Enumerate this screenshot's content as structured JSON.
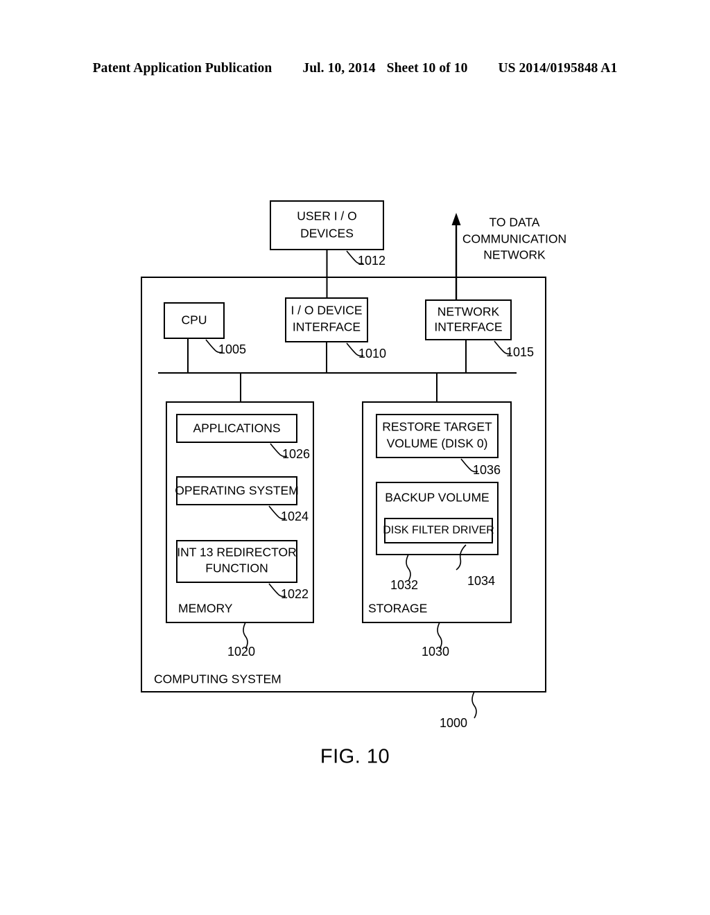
{
  "header": {
    "publication": "Patent Application Publication",
    "date": "Jul. 10, 2014",
    "sheet": "Sheet 10 of 10",
    "number": "US 2014/0195848 A1"
  },
  "figure": {
    "caption": "FIG. 10",
    "system_label": "COMPUTING SYSTEM",
    "system_ref": "1000",
    "external": {
      "user_io_label_line1": "USER  I / O",
      "user_io_label_line2": "DEVICES",
      "user_io_ref": "1012",
      "network_note_line1": "TO DATA",
      "network_note_line2": "COMMUNICATION",
      "network_note_line3": "NETWORK"
    },
    "bus_row": [
      {
        "label_line1": "CPU",
        "label_line2": "",
        "ref": "1005"
      },
      {
        "label_line1": "I / O DEVICE",
        "label_line2": "INTERFACE",
        "ref": "1010"
      },
      {
        "label_line1": "NETWORK",
        "label_line2": "INTERFACE",
        "ref": "1015"
      }
    ],
    "memory": {
      "label": "MEMORY",
      "ref": "1020",
      "items": [
        {
          "label_line1": "APPLICATIONS",
          "label_line2": "",
          "ref": "1026"
        },
        {
          "label_line1": "OPERATING SYSTEM",
          "label_line2": "",
          "ref": "1024"
        },
        {
          "label_line1": "INT 13 REDIRECTOR",
          "label_line2": "FUNCTION",
          "ref": "1022"
        }
      ]
    },
    "storage": {
      "label": "STORAGE",
      "ref": "1030",
      "restore_target": {
        "label_line1": "RESTORE TARGET",
        "label_line2": "VOLUME (DISK 0)",
        "ref": "1036"
      },
      "backup_volume": {
        "label": "BACKUP VOLUME",
        "ref": "1032",
        "inner": {
          "label": "DISK FILTER DRIVER",
          "ref": "1034"
        }
      }
    }
  },
  "colors": {
    "ink": "#000000",
    "paper": "#ffffff"
  }
}
